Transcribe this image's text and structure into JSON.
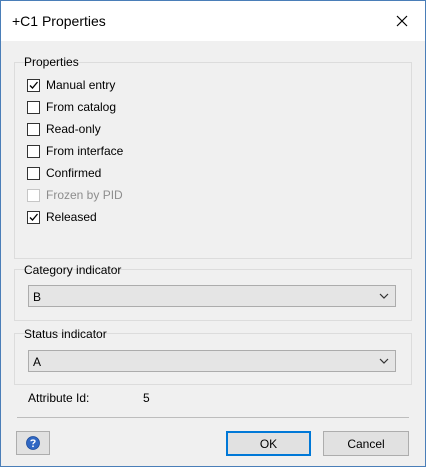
{
  "window": {
    "title": "+C1 Properties",
    "close_icon": "close-icon"
  },
  "properties_group": {
    "title": "Properties",
    "checkboxes": [
      {
        "label": "Manual entry",
        "checked": true,
        "enabled": true
      },
      {
        "label": "From catalog",
        "checked": false,
        "enabled": true
      },
      {
        "label": "Read-only",
        "checked": false,
        "enabled": true
      },
      {
        "label": "From interface",
        "checked": false,
        "enabled": true
      },
      {
        "label": "Confirmed",
        "checked": false,
        "enabled": true
      },
      {
        "label": "Frozen by PID",
        "checked": false,
        "enabled": false
      },
      {
        "label": "Released",
        "checked": true,
        "enabled": true
      }
    ]
  },
  "category_group": {
    "title": "Category indicator",
    "value": "B"
  },
  "status_group": {
    "title": "Status indicator",
    "value": "A"
  },
  "attribute": {
    "label": "Attribute Id:",
    "value": "5"
  },
  "footer": {
    "help_icon": "help-icon",
    "ok_label": "OK",
    "cancel_label": "Cancel"
  },
  "colors": {
    "accent": "#0078d7",
    "window_border": "#4a7eb8",
    "dialog_bg": "#f0f0f0"
  }
}
